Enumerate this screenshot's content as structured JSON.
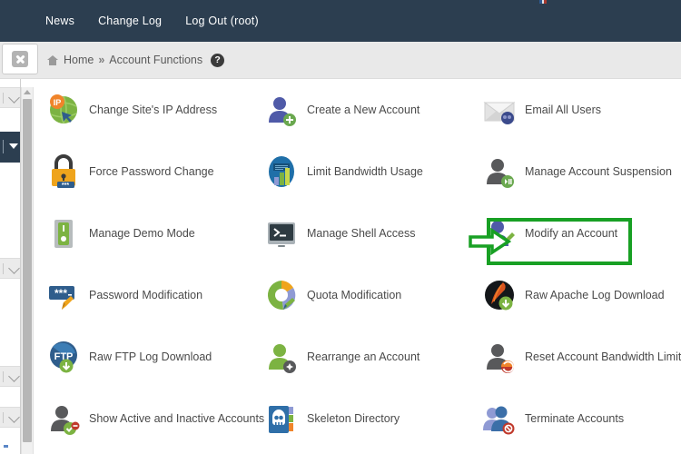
{
  "header": {
    "nav_items": [
      {
        "label": "News",
        "name": "nav-news"
      },
      {
        "label": "Change Log",
        "name": "nav-change-log"
      },
      {
        "label": "Log Out (root)",
        "name": "nav-log-out"
      }
    ],
    "background_color": "#2c3e50"
  },
  "breadcrumb": {
    "home_label": "Home",
    "separator": "»",
    "current_label": "Account Functions",
    "help_label": "?"
  },
  "sidebar": {
    "close_button_label": "x"
  },
  "main": {
    "grid": [
      [
        {
          "label": "Change Site's IP Address",
          "icon": "globe-ip-icon",
          "name": "tile-change-site-ip-address"
        },
        {
          "label": "Create a New Account",
          "icon": "user-add-icon",
          "name": "tile-create-a-new-account"
        },
        {
          "label": "Email All Users",
          "icon": "envelope-users-icon",
          "name": "tile-email-all-users"
        }
      ],
      [
        {
          "label": "Force Password Change",
          "icon": "padlock-icon",
          "name": "tile-force-password-change"
        },
        {
          "label": "Limit Bandwidth Usage",
          "icon": "bar-chart-icon",
          "name": "tile-limit-bandwidth-usage"
        },
        {
          "label": "Manage Account Suspension",
          "icon": "user-pause-icon",
          "name": "tile-manage-account-suspension"
        }
      ],
      [
        {
          "label": "Manage Demo Mode",
          "icon": "toggle-switch-icon",
          "name": "tile-manage-demo-mode"
        },
        {
          "label": "Manage Shell Access",
          "icon": "terminal-icon",
          "name": "tile-manage-shell-access"
        },
        {
          "label": "Modify an Account",
          "icon": "user-edit-icon",
          "name": "tile-modify-an-account"
        }
      ],
      [
        {
          "label": "Password Modification",
          "icon": "password-field-icon",
          "name": "tile-password-modification"
        },
        {
          "label": "Quota Modification",
          "icon": "pie-chart-icon",
          "name": "tile-quota-modification"
        },
        {
          "label": "Raw Apache Log Download",
          "icon": "apache-feather-download-icon",
          "name": "tile-raw-apache-log-download"
        }
      ],
      [
        {
          "label": "Raw FTP Log Download",
          "icon": "ftp-download-icon",
          "name": "tile-raw-ftp-log-download"
        },
        {
          "label": "Rearrange an Account",
          "icon": "user-move-icon",
          "name": "tile-rearrange-an-account"
        },
        {
          "label": "Reset Account Bandwidth Limit",
          "icon": "user-reset-icon",
          "name": "tile-reset-account-bandwidth-limit"
        }
      ],
      [
        {
          "label": "Show Active and Inactive Accounts",
          "icon": "user-check-icon",
          "name": "tile-show-active-and-inactive-accounts"
        },
        {
          "label": "Skeleton Directory",
          "icon": "skull-folder-icon",
          "name": "tile-skeleton-directory"
        },
        {
          "label": "Terminate Accounts",
          "icon": "users-delete-icon",
          "name": "tile-terminate-accounts"
        }
      ]
    ]
  },
  "annotation": {
    "highlight_color": "#18a024",
    "target_label": "Modify an Account"
  }
}
